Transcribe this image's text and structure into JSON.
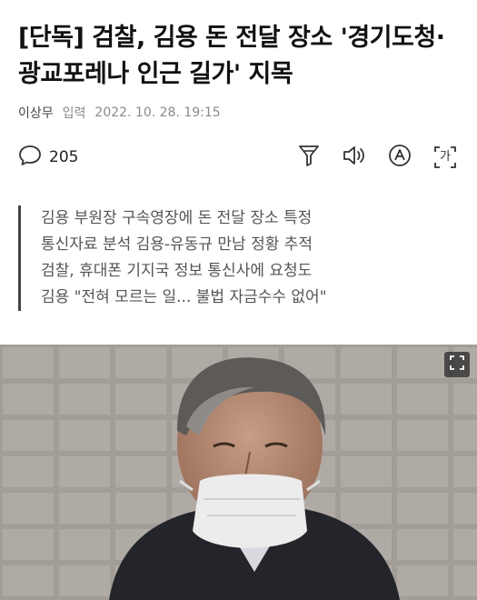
{
  "article": {
    "headline": "[단독] 검찰, 김용 돈 전달 장소 '경기도청·광교포레나 인근 길가' 지목",
    "author": "이상무",
    "input_label": "입력",
    "timestamp": "2022. 10. 28. 19:15"
  },
  "toolbar": {
    "comment_count": "205",
    "icons": [
      "comment-icon",
      "summary-icon",
      "speaker-icon",
      "font-size-icon",
      "translate-icon"
    ],
    "translate_glyph": "가"
  },
  "summary": {
    "lines": [
      "김용 부원장 구속영장에 돈 전달 장소 특정",
      "통신자료 분석 김용-유동규 만남 정황 추적",
      "검찰, 휴대폰 기지국 정보 통신사에 요청도",
      "김용 \"전혀 모르는 일... 불법 자금수수 없어\""
    ]
  },
  "photo": {
    "description_icon": "expand-icon"
  }
}
